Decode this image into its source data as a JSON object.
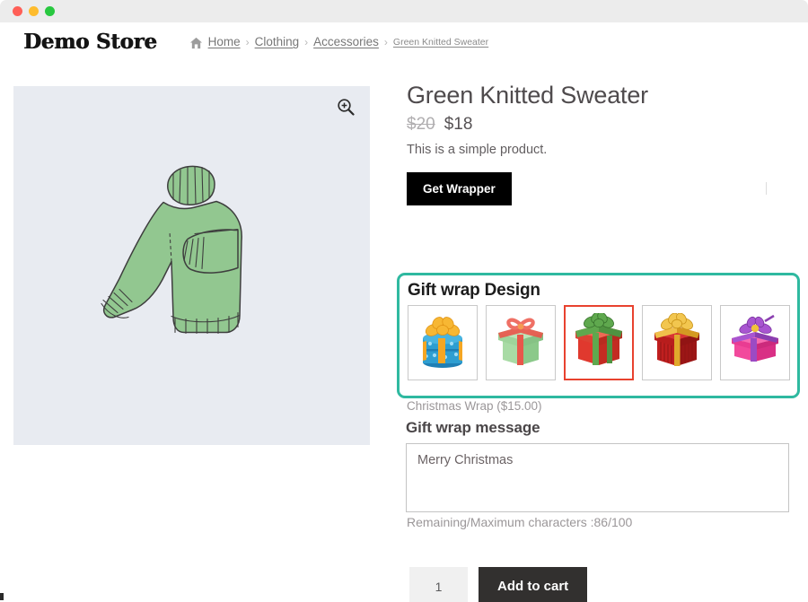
{
  "window": {
    "traffic_lights": [
      "close",
      "minimize",
      "maximize"
    ],
    "colors": {
      "close": "#ff5f57",
      "minimize": "#febc2e",
      "maximize": "#28c840"
    }
  },
  "header": {
    "brand": "Demo Store",
    "home_icon": "home-icon",
    "breadcrumb": [
      {
        "label": "Home",
        "current": false
      },
      {
        "label": "Clothing",
        "current": false
      },
      {
        "label": "Accessories",
        "current": false
      },
      {
        "label": "Green Knitted Sweater",
        "current": true
      }
    ],
    "separator": "›"
  },
  "gallery": {
    "zoom_icon": "magnifier-plus-icon",
    "image_alt": "green-knitted-sweater-illustration",
    "background_color": "#e8ebf1",
    "sweater_color": "#90c48e"
  },
  "product": {
    "title": "Green Knitted Sweater",
    "price_old": "$20",
    "price_new": "$18",
    "description": "This is a simple product.",
    "get_wrapper_label": "Get Wrapper"
  },
  "giftwrap": {
    "border_color": "#2fb9a0",
    "selected_border_color": "#e8422f",
    "title": "Gift wrap Design",
    "selected_index": 2,
    "designs": [
      {
        "name": "blue-polka-dot-gift-box",
        "selected": false
      },
      {
        "name": "green-gift-box-coral-bow",
        "selected": false
      },
      {
        "name": "red-gift-box-green-ribbon",
        "selected": true
      },
      {
        "name": "dark-red-gift-box-gold-ribbon",
        "selected": false
      },
      {
        "name": "pink-gift-box-purple-ribbon",
        "selected": false
      }
    ],
    "selected_label": "Christmas Wrap ($15.00)"
  },
  "message": {
    "title": "Gift wrap message",
    "value": "Merry Christmas",
    "placeholder": "",
    "counter": "Remaining/Maximum characters :86/100"
  },
  "cart": {
    "quantity": "1",
    "add_to_cart_label": "Add to cart"
  }
}
